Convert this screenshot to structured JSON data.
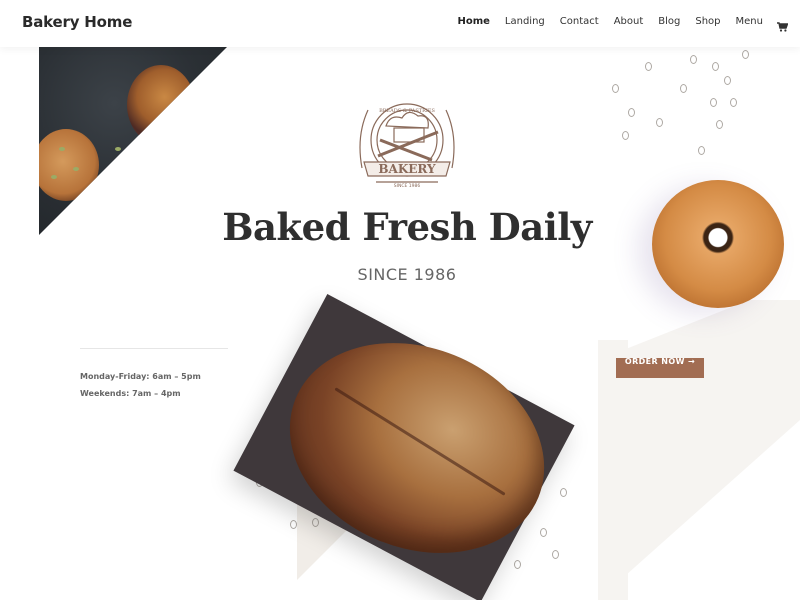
{
  "header": {
    "brand": "Bakery Home",
    "nav": [
      {
        "label": "Home",
        "active": true
      },
      {
        "label": "Landing",
        "active": false
      },
      {
        "label": "Contact",
        "active": false
      },
      {
        "label": "About",
        "active": false
      },
      {
        "label": "Blog",
        "active": false
      },
      {
        "label": "Shop",
        "active": false
      },
      {
        "label": "Menu",
        "active": false
      }
    ],
    "cart_icon": "shopping-cart-icon"
  },
  "hero": {
    "logo": {
      "top_text": "BREADS & PASTRIES",
      "name": "BAKERY",
      "bottom_text": "SINCE 1986"
    },
    "title": "Baked Fresh Daily",
    "subtitle": "SINCE 1986"
  },
  "hours": [
    "Monday-Friday: 6am – 5pm",
    "Weekends: 7am – 4pm"
  ],
  "cta": {
    "label": "ORDER NOW →"
  },
  "colors": {
    "accent": "#a26d53",
    "heading": "#2f2f2f",
    "cream": "#f6f4f1"
  }
}
